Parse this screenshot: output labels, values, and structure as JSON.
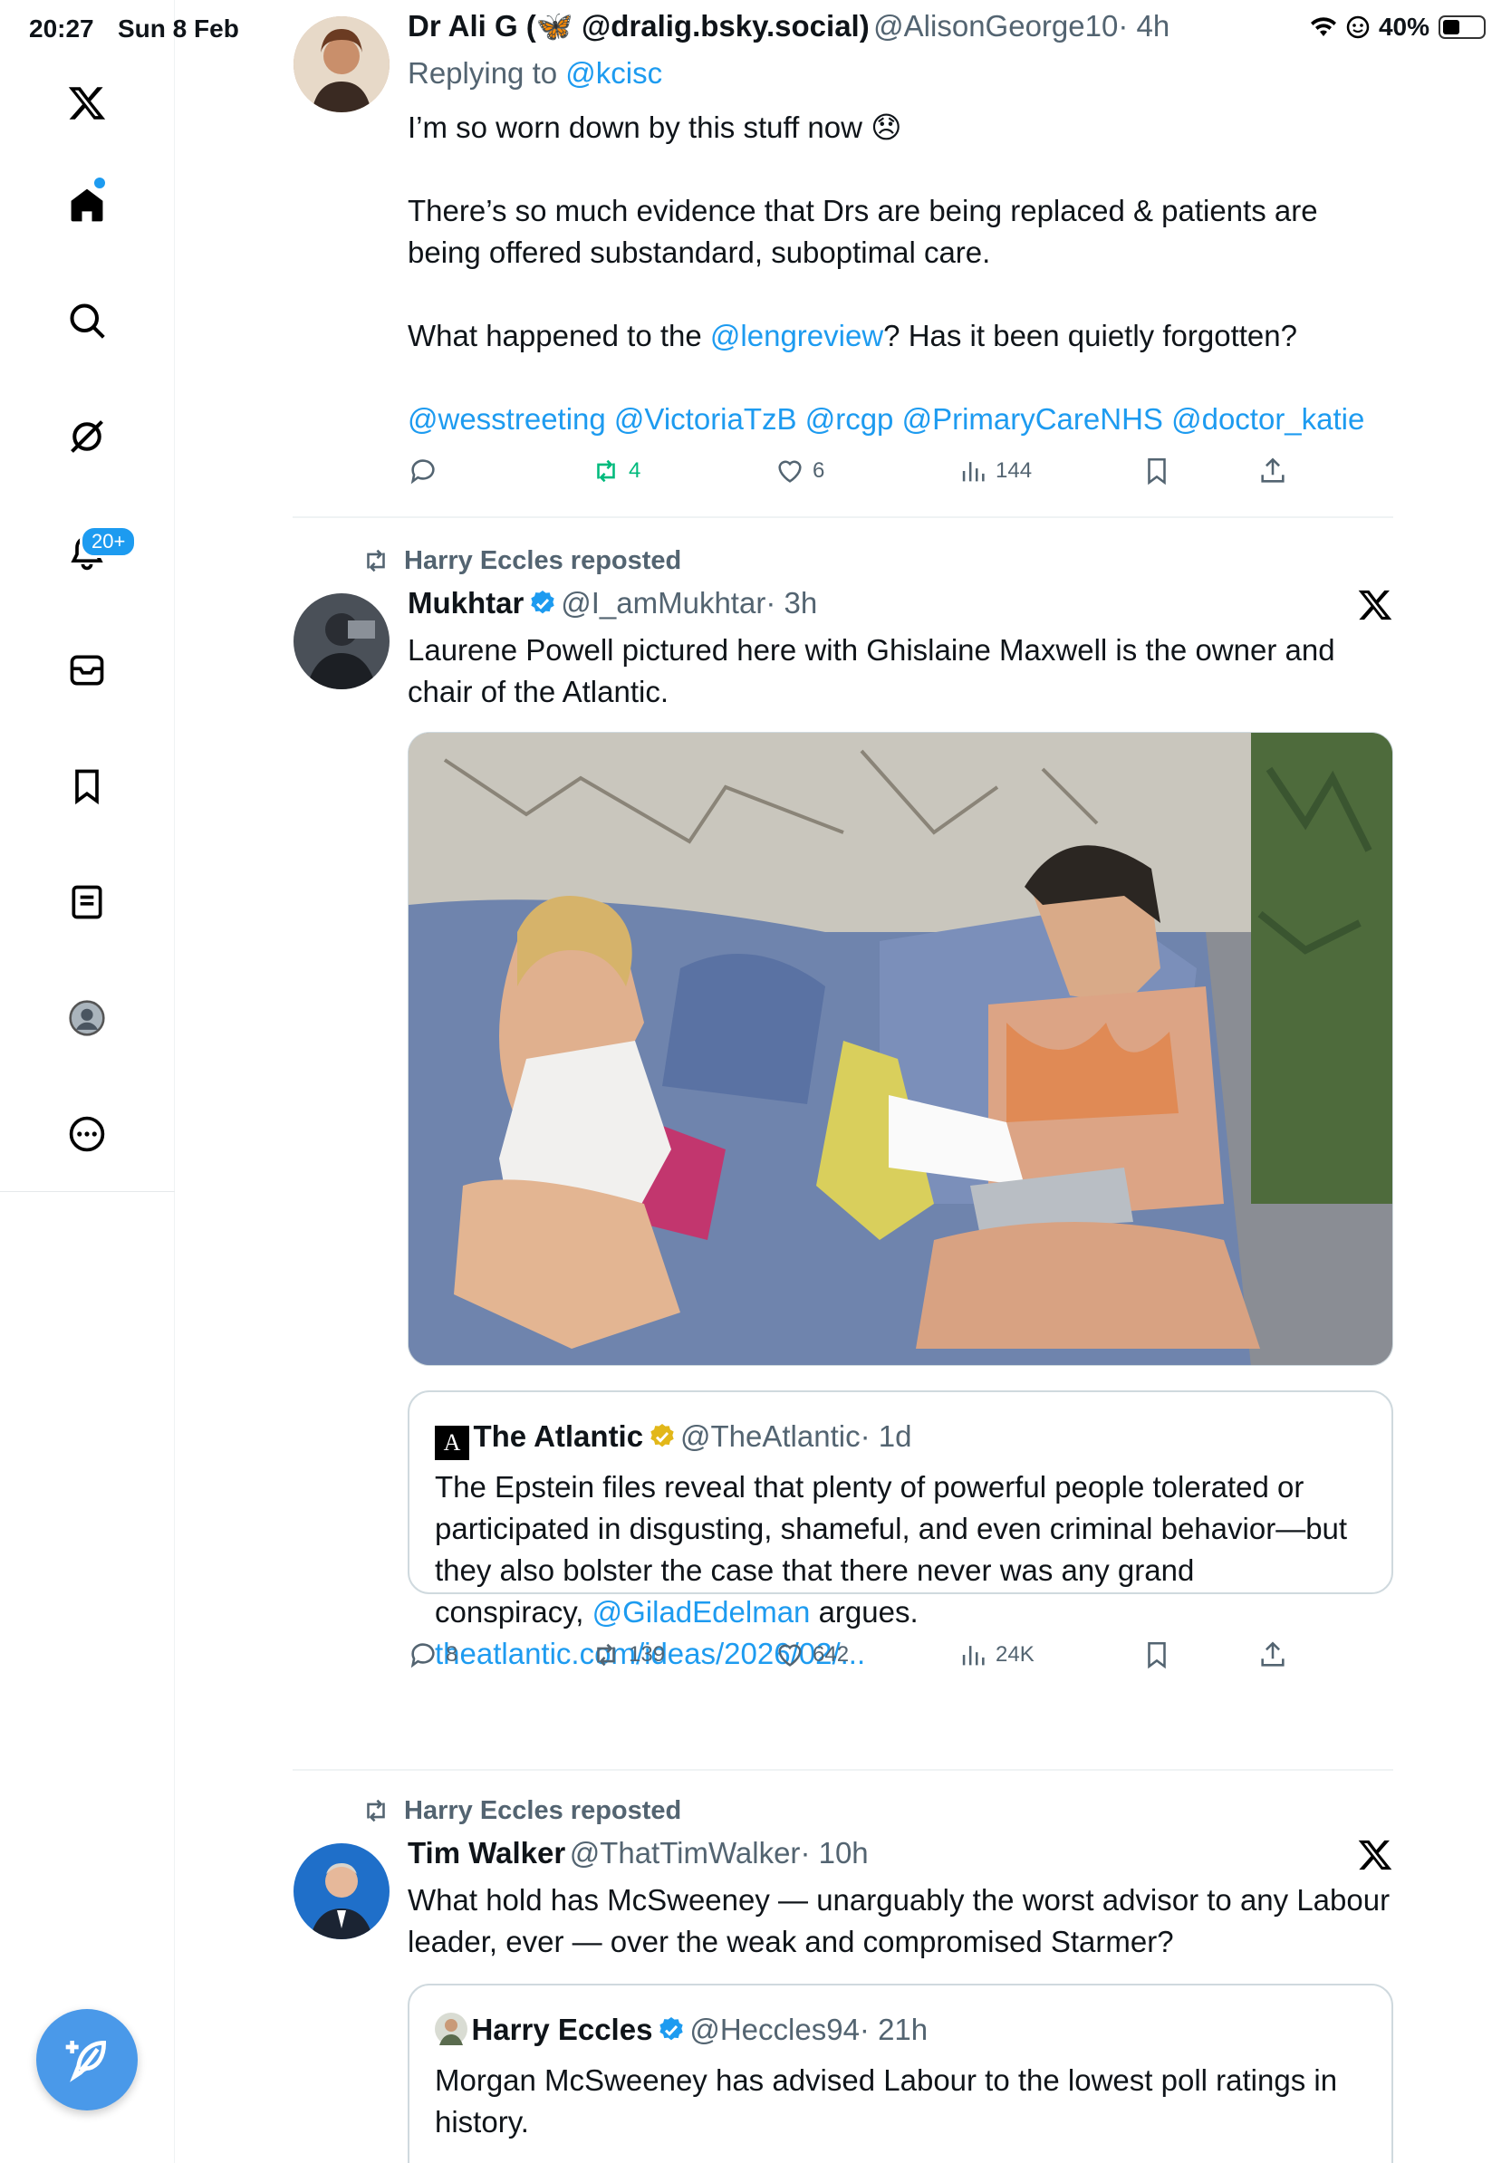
{
  "status_bar": {
    "time": "20:27",
    "date": "Sun 8 Feb",
    "battery": "40%"
  },
  "sidebar": {
    "notifications_badge": "20+",
    "items": [
      "x-logo",
      "home",
      "search",
      "grok",
      "notifications",
      "messages",
      "bookmarks",
      "lists",
      "profile",
      "more"
    ]
  },
  "tweets": [
    {
      "author_name": "Dr Ali G (🦋 @dralig.bsky.social)",
      "handle": "@AlisonGeorge10",
      "time": "· 4h",
      "replying_to_label": "Replying to",
      "replying_to": "@kcisc",
      "text1": "I’m so worn down by this stuff now 😞",
      "text2": "There’s so much evidence that Drs are being replaced & patients are being offered substandard, suboptimal care.",
      "text3a": "What happened to the",
      "text3_link": "@lengreview",
      "text3b": "? Has it been quietly forgotten?",
      "mentions": "@wesstreeting @VictoriaTzB @rcgp @PrimaryCareNHS @doctor_katie",
      "reposts": "4",
      "likes": "6",
      "views": "144"
    },
    {
      "repost_label": "Harry Eccles reposted",
      "author_name": "Mukhtar",
      "handle": "@I_amMukhtar",
      "time": "· 3h",
      "text": "Laurene Powell pictured here with Ghislaine Maxwell is the owner and chair of the Atlantic.",
      "quote": {
        "logo_letter": "A",
        "author_name": "The Atlantic",
        "handle": "@TheAtlantic",
        "time": "· 1d",
        "text_a": "The Epstein files reveal that plenty of powerful people tolerated or participated in disgusting, shameful, and even criminal behavior—but they also bolster the case that there never was any grand conspiracy,",
        "mention": "@GiladEdelman",
        "text_b": "argues.",
        "url": "theatlantic.com/ideas/2026/02/..."
      },
      "replies": "8",
      "reposts": "139",
      "likes": "642",
      "views": "24K"
    },
    {
      "repost_label": "Harry Eccles reposted",
      "author_name": "Tim Walker",
      "handle": "@ThatTimWalker",
      "time": "· 10h",
      "text": "What hold has McSweeney — unarguably the worst advisor to any Labour leader, ever — over the weak and compromised Starmer?",
      "quote": {
        "author_name": "Harry Eccles",
        "handle": "@Heccles94",
        "time": "· 21h",
        "text": "Morgan McSweeney has advised Labour to the lowest poll ratings in history."
      }
    }
  ],
  "colors": {
    "accent": "#1d9bf0",
    "repost_green": "#00ba7c",
    "muted": "#536471",
    "compose_button": "#4a99e9"
  }
}
